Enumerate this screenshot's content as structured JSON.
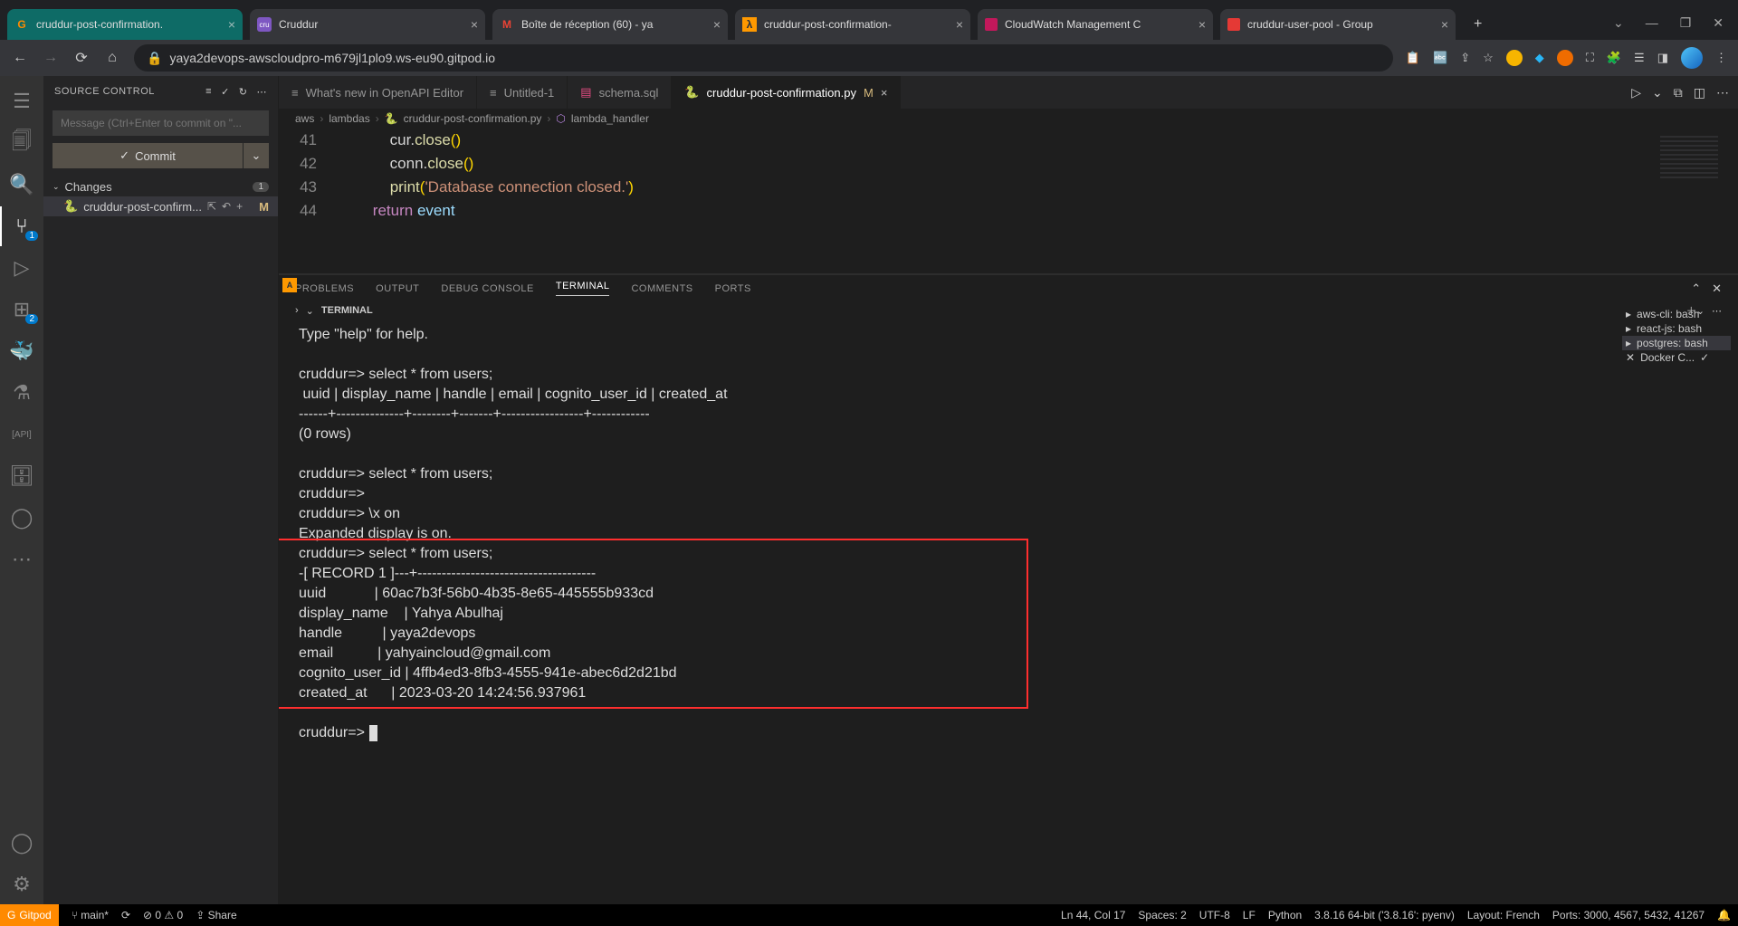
{
  "chrome": {
    "tabs": [
      {
        "title": "cruddur-post-confirmation.",
        "favicon": "G",
        "color": "#ff8a00",
        "active": true
      },
      {
        "title": "Cruddur",
        "favicon": "●",
        "color": "#7e57c2"
      },
      {
        "title": "Boîte de réception (60) - ya",
        "favicon": "M",
        "color": "#ea4335"
      },
      {
        "title": "cruddur-post-confirmation-",
        "favicon": "λ",
        "color": "#ff9900"
      },
      {
        "title": "CloudWatch Management C",
        "favicon": "◧",
        "color": "#c2185b"
      },
      {
        "title": "cruddur-user-pool - Group",
        "favicon": "◧",
        "color": "#e53935"
      }
    ],
    "url": "yaya2devops-awscloudpro-m679jl1plo9.ws-eu90.gitpod.io"
  },
  "scm": {
    "title": "SOURCE CONTROL",
    "msg_placeholder": "Message (Ctrl+Enter to commit on \"...",
    "commit_label": "Commit",
    "changes_label": "Changes",
    "changes_count": "1",
    "file": "cruddur-post-confirm...",
    "file_status": "M"
  },
  "editor": {
    "tabs": [
      {
        "label": "What's new in OpenAPI Editor",
        "icon": "≡"
      },
      {
        "label": "Untitled-1",
        "icon": "≡"
      },
      {
        "label": "schema.sql",
        "icon": "▤"
      },
      {
        "label": "cruddur-post-confirmation.py",
        "icon": "🐍",
        "modified": "M",
        "active": true
      }
    ],
    "breadcrumbs": [
      "aws",
      "lambdas",
      "cruddur-post-confirmation.py",
      "lambda_handler"
    ],
    "lines": {
      "41": "            cur.close()",
      "42": "            conn.close()",
      "43": "            print('Database connection closed.')",
      "44": "        return event"
    }
  },
  "panel": {
    "tabs": [
      "PROBLEMS",
      "OUTPUT",
      "DEBUG CONSOLE",
      "TERMINAL",
      "COMMENTS",
      "PORTS"
    ],
    "active": "TERMINAL",
    "sub": "TERMINAL",
    "terminals": [
      {
        "name": "aws-cli: bash",
        "icon": "▸"
      },
      {
        "name": "react-js: bash",
        "icon": "▸"
      },
      {
        "name": "postgres: bash",
        "icon": "▸",
        "sel": true
      },
      {
        "name": "Docker C...",
        "icon": "✕",
        "check": true
      }
    ],
    "output": "Type \"help\" for help.\n\ncruddur=> select * from users;\n uuid | display_name | handle | email | cognito_user_id | created_at\n------+--------------+--------+-------+-----------------+------------\n(0 rows)\n\ncruddur=> select * from users;\ncruddur=>\ncruddur=> \\x on\nExpanded display is on.\ncruddur=> select * from users;\n-[ RECORD 1 ]---+-------------------------------------\nuuid            | 60ac7b3f-56b0-4b35-8e65-445555b933cd\ndisplay_name    | Yahya Abulhaj\nhandle          | yaya2devops\nemail           | yahyaincloud@gmail.com\ncognito_user_id | 4ffb4ed3-8fb3-4555-941e-abec6d2d21bd\ncreated_at      | 2023-03-20 14:24:56.937961\n\ncruddur=> "
  },
  "status": {
    "gitpod": "Gitpod",
    "branch": "main*",
    "problems": "0",
    "warnings": "0",
    "share": "Share",
    "ln": "Ln 44, Col 17",
    "spaces": "Spaces: 2",
    "enc": "UTF-8",
    "eol": "LF",
    "lang": "Python",
    "py": "3.8.16 64-bit ('3.8.16': pyenv)",
    "layout": "Layout: French",
    "ports": "Ports: 3000, 4567, 5432, 41267"
  }
}
